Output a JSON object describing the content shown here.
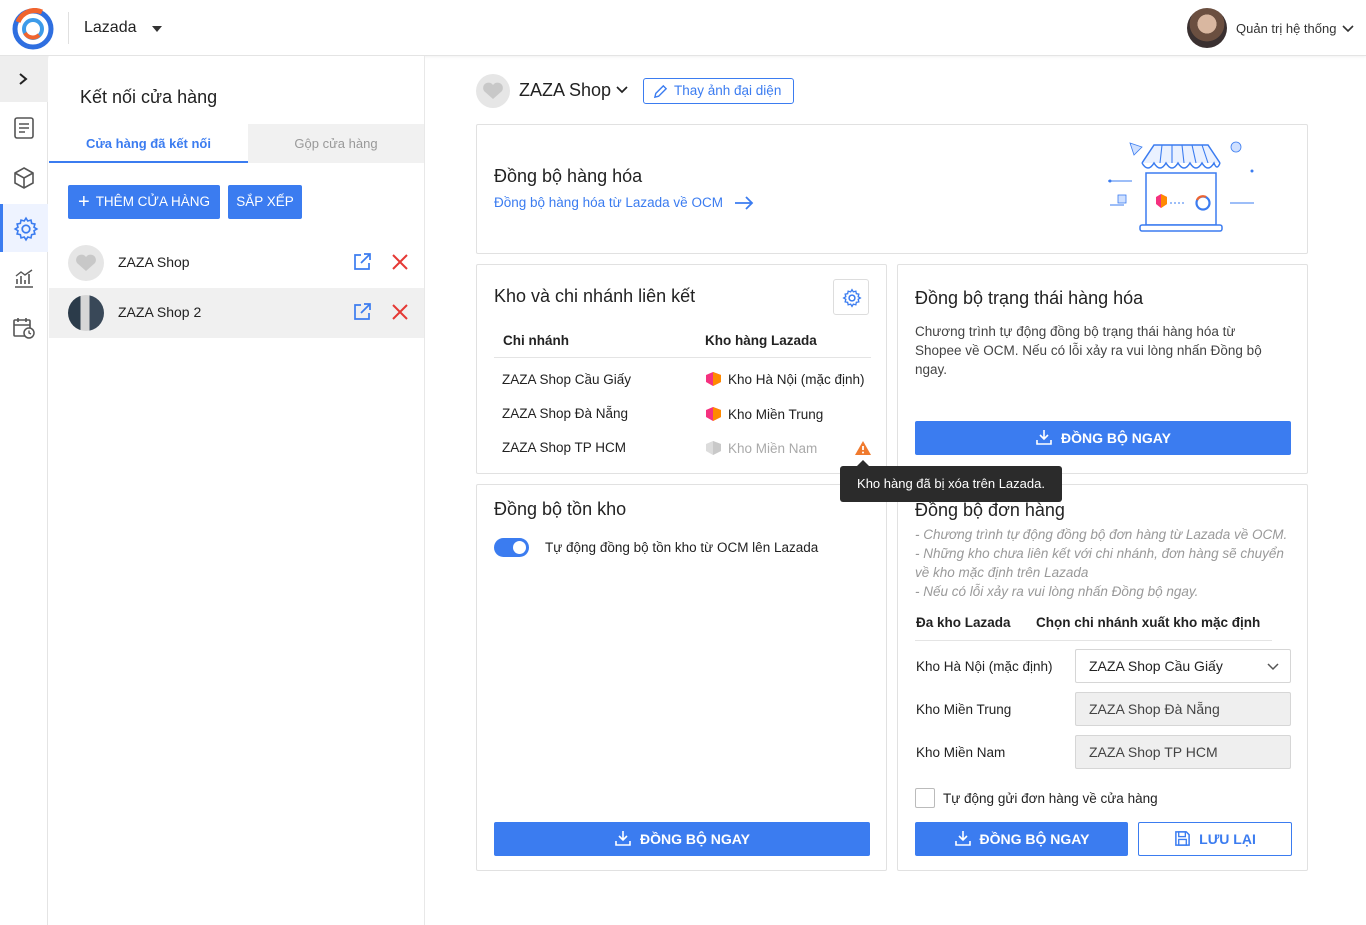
{
  "topbar": {
    "app_name": "Lazada",
    "user_name": "Quản trị hệ thống"
  },
  "panel": {
    "title": "Kết nối cửa hàng",
    "tabs": [
      "Cửa hàng đã kết nối",
      "Gộp cửa hàng"
    ],
    "add_button": "THÊM CỬA HÀNG",
    "sort_button": "SẮP XẾP",
    "shops": [
      {
        "name": "ZAZA Shop"
      },
      {
        "name": "ZAZA Shop 2"
      }
    ]
  },
  "main": {
    "shop_name": "ZAZA Shop",
    "change_avatar": "Thay ảnh đại diện",
    "sync_goods": {
      "title": "Đồng bộ hàng hóa",
      "link": "Đồng bộ hàng hóa từ Lazada về OCM"
    },
    "warehouse": {
      "title": "Kho và chi nhánh liên kết",
      "col_branch": "Chi nhánh",
      "col_warehouse": "Kho hàng Lazada",
      "rows": [
        {
          "branch": "ZAZA Shop Cầu Giấy",
          "warehouse": "Kho Hà Nội (mặc định)"
        },
        {
          "branch": "ZAZA Shop Đà Nẵng",
          "warehouse": "Kho Miền Trung"
        },
        {
          "branch": "ZAZA Shop TP HCM",
          "warehouse": "Kho Miền Nam"
        }
      ],
      "tooltip": "Kho hàng đã bị xóa trên Lazada."
    },
    "sync_status": {
      "title": "Đồng bộ trạng thái hàng hóa",
      "desc_lines": [
        "Chương trình tự động đồng bộ trạng thái hàng hóa từ",
        "Shopee về OCM. Nếu có lỗi xảy ra vui lòng nhấn Đồng bộ",
        "ngay."
      ],
      "button": "ĐỒNG BỘ NGAY"
    },
    "sync_stock": {
      "title": "Đồng bộ tồn kho",
      "toggle_label": "Tự động đồng bộ tồn kho từ OCM lên Lazada",
      "toggle_on": true,
      "button": "ĐỒNG BỘ NGAY"
    },
    "sync_orders": {
      "title": "Đồng bộ đơn hàng",
      "notes": [
        "- Chương trình tự động đồng bộ đơn hàng từ Lazada về OCM.",
        "- Những kho chưa liên kết với chi nhánh, đơn hàng sẽ chuyển",
        "về kho mặc định trên Lazada",
        "- Nếu có lỗi xảy ra vui lòng nhấn Đồng bộ ngay."
      ],
      "col_wh": "Đa kho Lazada",
      "col_branch": "Chọn chi nhánh xuất kho mặc định",
      "rows": [
        {
          "warehouse": "Kho Hà Nội (mặc định)",
          "branch": "ZAZA Shop Cầu Giấy"
        },
        {
          "warehouse": "Kho Miền Trung",
          "branch": "ZAZA Shop Đà Nẵng"
        },
        {
          "warehouse": "Kho Miền Nam",
          "branch": "ZAZA Shop TP HCM"
        }
      ],
      "checkbox_label": "Tự động gửi đơn hàng về cửa hàng",
      "sync_button": "ĐỒNG BỘ NGAY",
      "save_button": "LƯU LẠI"
    }
  },
  "colors": {
    "primary": "#3b7cf0",
    "danger": "#e53935",
    "warning": "#f07a2e"
  }
}
